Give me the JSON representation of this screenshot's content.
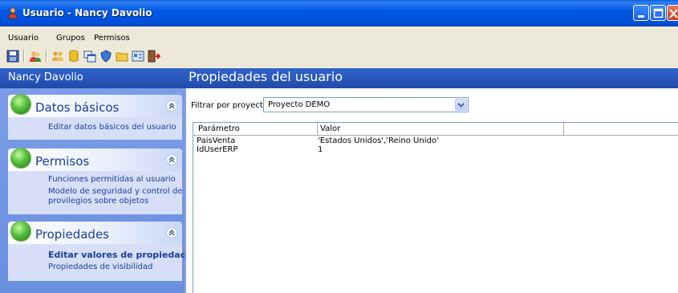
{
  "window": {
    "title": "Usuario - Nancy Davolio"
  },
  "menu": [
    "Usuario",
    "Grupos",
    "Permisos"
  ],
  "left_pane": {
    "title": "Nancy Davolio",
    "groups": [
      {
        "label": "Datos básicos",
        "links": [
          "Editar datos básicos del usuario"
        ]
      },
      {
        "label": "Permisos",
        "links": [
          "Funciones permitidas al usuario",
          "Modelo de seguridad y control de",
          "provilegios sobre objetos"
        ]
      },
      {
        "label": "Propiedades",
        "links": [
          "Editar valores de propiedades",
          "Propiedades de visibilidad"
        ]
      }
    ]
  },
  "main": {
    "title": "Propiedades del usuario",
    "filter_label": "Filtrar por proyecto:",
    "project": "Proyecto DEMO",
    "columns": [
      "Parámetro",
      "Valor"
    ],
    "rows": [
      {
        "param": "PaisVenta",
        "value": "'Estados Unidos','Reino Unido'"
      },
      {
        "param": "IdUserERP",
        "value": "1"
      }
    ]
  }
}
